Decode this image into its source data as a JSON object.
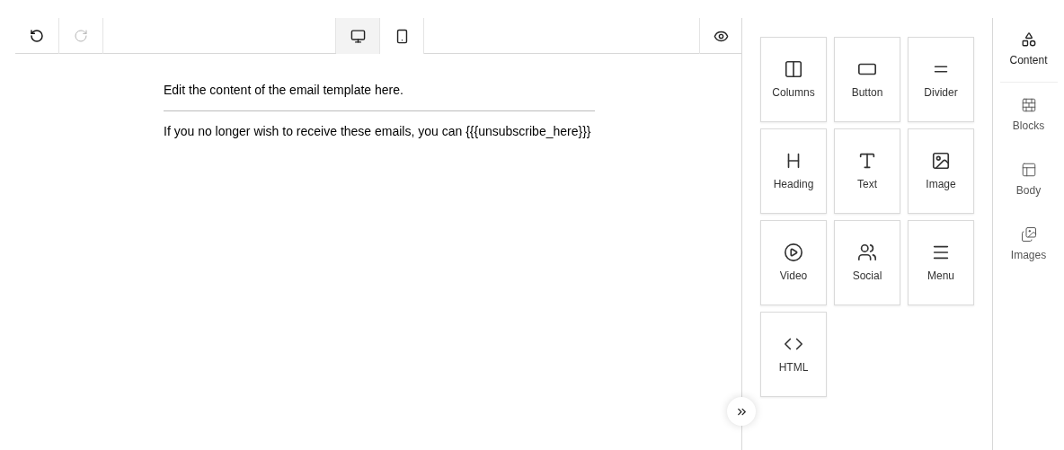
{
  "toolbar": {
    "history": [
      {
        "kind": "undo",
        "disabled": false
      },
      {
        "kind": "redo",
        "disabled": true
      }
    ],
    "devices": [
      {
        "kind": "desktop",
        "selected": true
      },
      {
        "kind": "mobile",
        "selected": false
      }
    ],
    "preview": {
      "kind": "eye"
    }
  },
  "canvas": {
    "blocks": [
      {
        "kind": "text",
        "text": "Edit the content of the email template here."
      },
      {
        "kind": "divider"
      },
      {
        "kind": "text",
        "text": "If you no longer wish to receive these emails, you can {{{unsubscribe_here}}}"
      }
    ]
  },
  "tools": [
    {
      "kind": "columns",
      "label": "Columns"
    },
    {
      "kind": "button",
      "label": "Button"
    },
    {
      "kind": "divider",
      "label": "Divider"
    },
    {
      "kind": "heading",
      "label": "Heading"
    },
    {
      "kind": "text",
      "label": "Text"
    },
    {
      "kind": "image",
      "label": "Image"
    },
    {
      "kind": "video",
      "label": "Video"
    },
    {
      "kind": "social",
      "label": "Social"
    },
    {
      "kind": "menu",
      "label": "Menu"
    },
    {
      "kind": "html",
      "label": "HTML"
    }
  ],
  "sidebar": {
    "tabs": [
      {
        "kind": "content",
        "label": "Content",
        "selected": true
      },
      {
        "kind": "blocks",
        "label": "Blocks",
        "selected": false
      },
      {
        "kind": "body",
        "label": "Body",
        "selected": false
      },
      {
        "kind": "images",
        "label": "Images",
        "selected": false
      }
    ]
  }
}
